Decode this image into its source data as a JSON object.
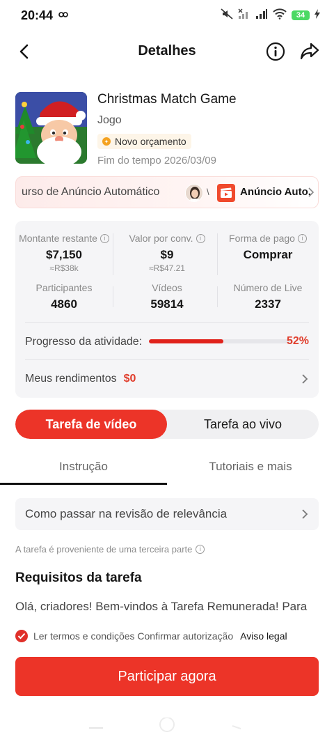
{
  "status_bar": {
    "time": "20:44",
    "battery": "34"
  },
  "nav": {
    "title": "Detalhes"
  },
  "game": {
    "title": "Christmas Match Game",
    "category": "Jogo",
    "budget_badge": "Novo orçamento",
    "end_time": "Fim do tempo 2026/03/09"
  },
  "ad_banner": {
    "left_text": "urso de Anúncio Automático",
    "separator": "\\",
    "right_text": "Anúncio Auto."
  },
  "stats": {
    "remaining_label": "Montante restante",
    "remaining_value": "$7,150",
    "remaining_sub": "≈R$38k",
    "per_conv_label": "Valor por conv.",
    "per_conv_value": "$9",
    "per_conv_sub": "≈R$47.21",
    "payment_label": "Forma de pago",
    "payment_value": "Comprar",
    "participants_label": "Participantes",
    "participants_value": "4860",
    "videos_label": "Vídeos",
    "videos_value": "59814",
    "live_label": "Número de Live",
    "live_value": "2337",
    "progress_label": "Progresso da atividade:",
    "progress_fraction": 0.52,
    "progress_text": "52%",
    "earnings_label": "Meus rendimentos",
    "earnings_value": "$0"
  },
  "task_types": {
    "video": "Tarefa de vídeo",
    "live": "Tarefa ao vivo"
  },
  "tabs": {
    "instruction": "Instrução",
    "tutorials": "Tutoriais e mais"
  },
  "relevance": "Como passar na revisão de relevância",
  "source_note": "A tarefa é proveniente de uma terceira parte",
  "requirements": {
    "title": "Requisitos da tarefa",
    "body": "Olá, criadores! Bem-vindos à Tarefa Remunerada! Para"
  },
  "terms": {
    "text": "Ler termos e condições Confirmar autorização",
    "link": "Aviso legal"
  },
  "cta": "Participar agora",
  "colors": {
    "accent": "#ec3428",
    "price_red": "#e03d2c",
    "card_bg": "#f5f5f7"
  }
}
